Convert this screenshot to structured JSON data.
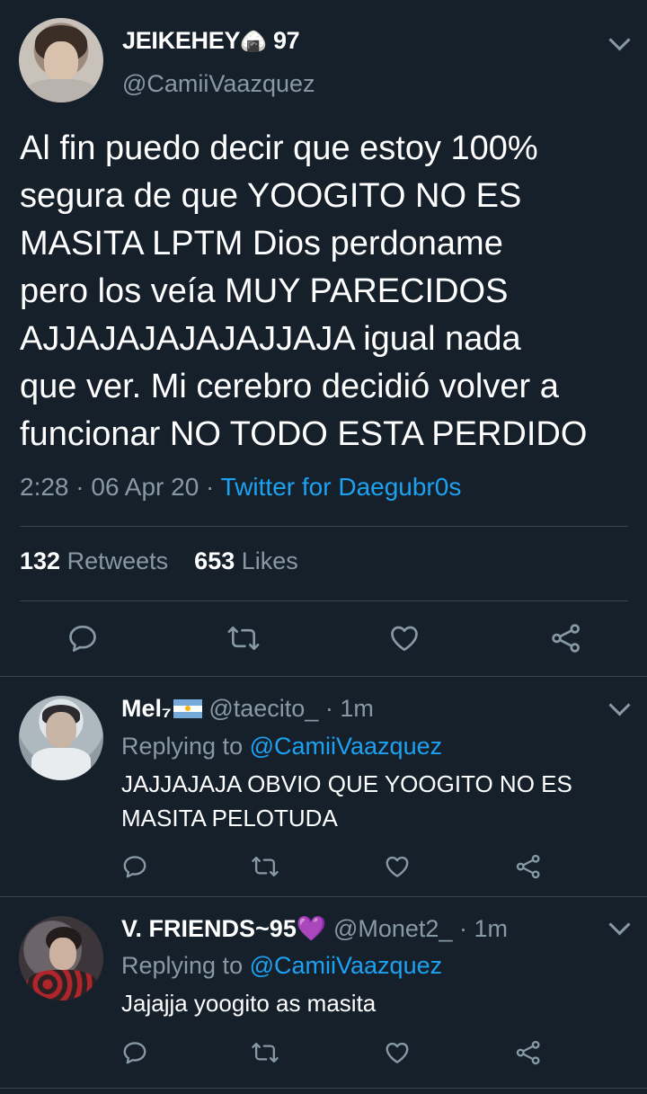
{
  "main_tweet": {
    "display_name": "JEIKEHEY",
    "name_emoji": "🍙",
    "name_suffix": "97",
    "handle": "@CamiiVaazquez",
    "text": "Al fin puedo decir que estoy 100%\nsegura de que YOOGITO NO ES\nMASITA LPTM Dios perdoname\npero los veía MUY PARECIDOS\nAJJAJAJAJAJAJJAJA igual nada\nque ver. Mi cerebro decidió volver a\nfuncionar NO TODO ESTA PERDIDO",
    "time": "2:28",
    "separator": "·",
    "date": "06 Apr 20",
    "source": "Twitter for Daegubr0s",
    "retweets_count": "132",
    "retweets_label": "Retweets",
    "likes_count": "653",
    "likes_label": "Likes"
  },
  "replies": [
    {
      "display_name": "Mel₇",
      "handle": "@taecito_",
      "separator": "·",
      "time": "1m",
      "replying_prefix": "Replying to",
      "replying_to": "@CamiiVaazquez",
      "text": "JAJJAJAJA OBVIO QUE YOOGITO NO ES MASITA PELOTUDA"
    },
    {
      "display_name": "V. FRIENDS~95",
      "name_emoji": "💜",
      "handle": "@Monet2_",
      "separator": "·",
      "time": "1m",
      "replying_prefix": "Replying to",
      "replying_to": "@CamiiVaazquez",
      "text": "Jajajja yoogito as masita"
    }
  ],
  "icons": [
    "reply-icon",
    "retweet-icon",
    "like-icon",
    "share-icon",
    "chevron-down-icon"
  ],
  "colors": {
    "background": "#15202b",
    "text": "#ffffff",
    "muted": "#8899a6",
    "link": "#1da1f2",
    "divider": "#38444d"
  }
}
